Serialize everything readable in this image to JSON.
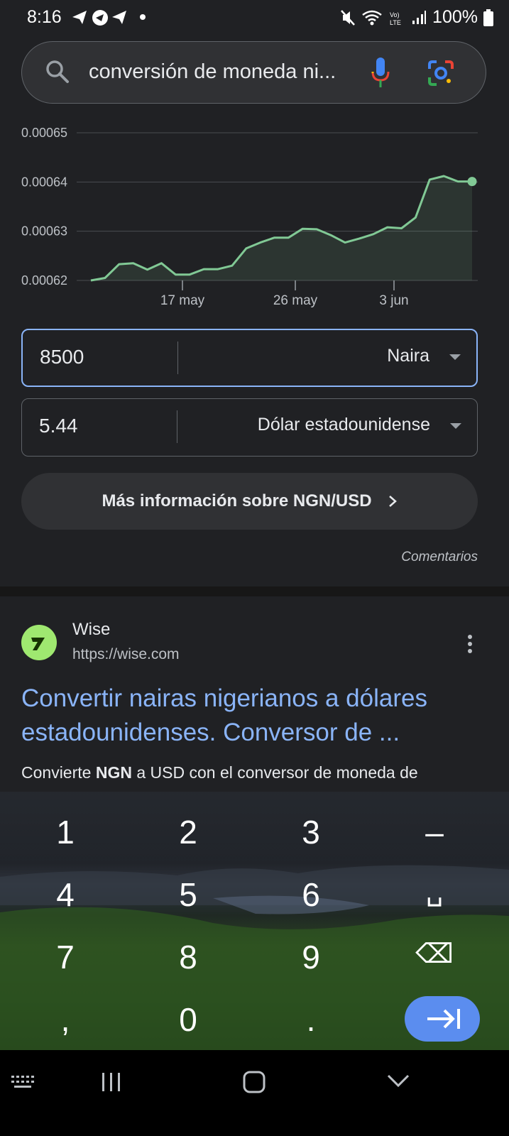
{
  "status_bar": {
    "time": "8:16",
    "battery": "100%"
  },
  "search": {
    "query": "conversión de moneda ni..."
  },
  "chart_data": {
    "type": "line",
    "x_ticks": [
      "17 may",
      "26 may",
      "3 jun"
    ],
    "y_ticks": [
      "0.00065",
      "0.00064",
      "0.00063",
      "0.00062"
    ],
    "ylim": [
      0.00062,
      0.00065
    ],
    "grid": true,
    "series": [
      {
        "color": "#81c995",
        "values": [
          0.00062,
          0.0006205,
          0.0006233,
          0.0006235,
          0.0006222,
          0.0006235,
          0.0006212,
          0.0006212,
          0.0006223,
          0.0006223,
          0.000623,
          0.0006265,
          0.0006277,
          0.0006287,
          0.0006287,
          0.0006305,
          0.0006304,
          0.0006292,
          0.0006277,
          0.0006285,
          0.0006294,
          0.0006308,
          0.0006306,
          0.0006328,
          0.0006405,
          0.0006412,
          0.0006401,
          0.0006401
        ]
      }
    ]
  },
  "converter": {
    "from_value": "8500",
    "from_unit": "Naira",
    "to_value": "5.44",
    "to_unit": "Dólar estadounidense",
    "more_info": "Más información sobre NGN/USD",
    "feedback": "Comentarios"
  },
  "result": {
    "site_name": "Wise",
    "url": "https://wise.com",
    "title": "Convertir nairas nigerianos a dólares estadounidenses. Conversor de ...",
    "snippet_a": "Convierte ",
    "snippet_bold": "NGN",
    "snippet_b": " a USD con el conversor de moneda de"
  },
  "keyboard": {
    "keys": [
      "1",
      "2",
      "3",
      "–",
      "4",
      "5",
      "6",
      "␣",
      "7",
      "8",
      "9",
      "⌫",
      ",",
      "0",
      "."
    ]
  }
}
